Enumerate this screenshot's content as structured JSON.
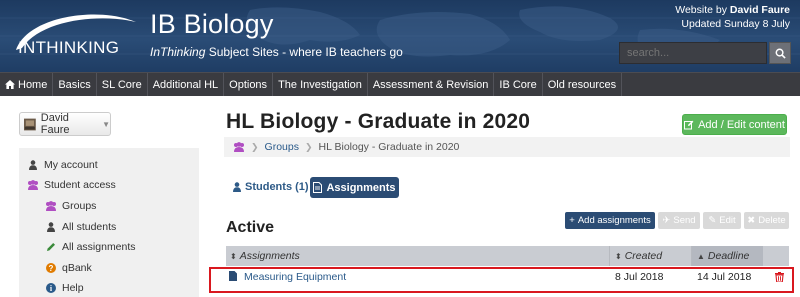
{
  "header": {
    "logo_text": "INTHINKING",
    "title": "IB Biology",
    "subtitle_brand": "InThinking",
    "subtitle_rest": " Subject Sites - where IB teachers go",
    "website_by_prefix": "Website by ",
    "website_by_name": "David Faure",
    "updated": "Updated Sunday 8 July",
    "search_placeholder": "search..."
  },
  "nav": {
    "items": [
      "Home",
      "Basics",
      "SL Core",
      "Additional HL",
      "Options",
      "The Investigation",
      "Assessment & Revision",
      "IB Core",
      "Old resources"
    ]
  },
  "sidebar": {
    "user_name": "David Faure",
    "items": [
      {
        "label": "My account",
        "icon": "user-icon",
        "color": "#444"
      },
      {
        "label": "Student access",
        "icon": "users-icon",
        "color": "#b04ec2"
      },
      {
        "label": "Groups",
        "icon": "users-icon",
        "color": "#b04ec2"
      },
      {
        "label": "All students",
        "icon": "user-icon",
        "color": "#444"
      },
      {
        "label": "All assignments",
        "icon": "pencil-icon",
        "color": "#3a8a3a"
      },
      {
        "label": "qBank",
        "icon": "question-icon",
        "color": "#e07b00"
      },
      {
        "label": "Help",
        "icon": "info-icon",
        "color": "#2a5a8a"
      }
    ]
  },
  "main": {
    "title": "HL Biology - Graduate in 2020",
    "add_edit_label": "Add / Edit content",
    "breadcrumb": {
      "groups": "Groups",
      "current": "HL Biology - Graduate in 2020"
    },
    "tabs": {
      "students": "Students (1)",
      "assignments": "Assignments"
    },
    "section_heading": "Active",
    "buttons": {
      "add_assignments": "Add assignments",
      "send": "Send",
      "edit": "Edit",
      "delete": "Delete"
    },
    "table": {
      "headers": [
        "Assignments",
        "Created",
        "Deadline"
      ],
      "rows": [
        {
          "name": "Measuring Equipment",
          "created": "8 Jul 2018",
          "deadline": "14 Jul 2018"
        }
      ]
    }
  },
  "colors": {
    "accent_navy": "#2b4c74",
    "green": "#5cb85c",
    "highlight_red": "#d9181f",
    "trash_red": "#d9181f"
  }
}
